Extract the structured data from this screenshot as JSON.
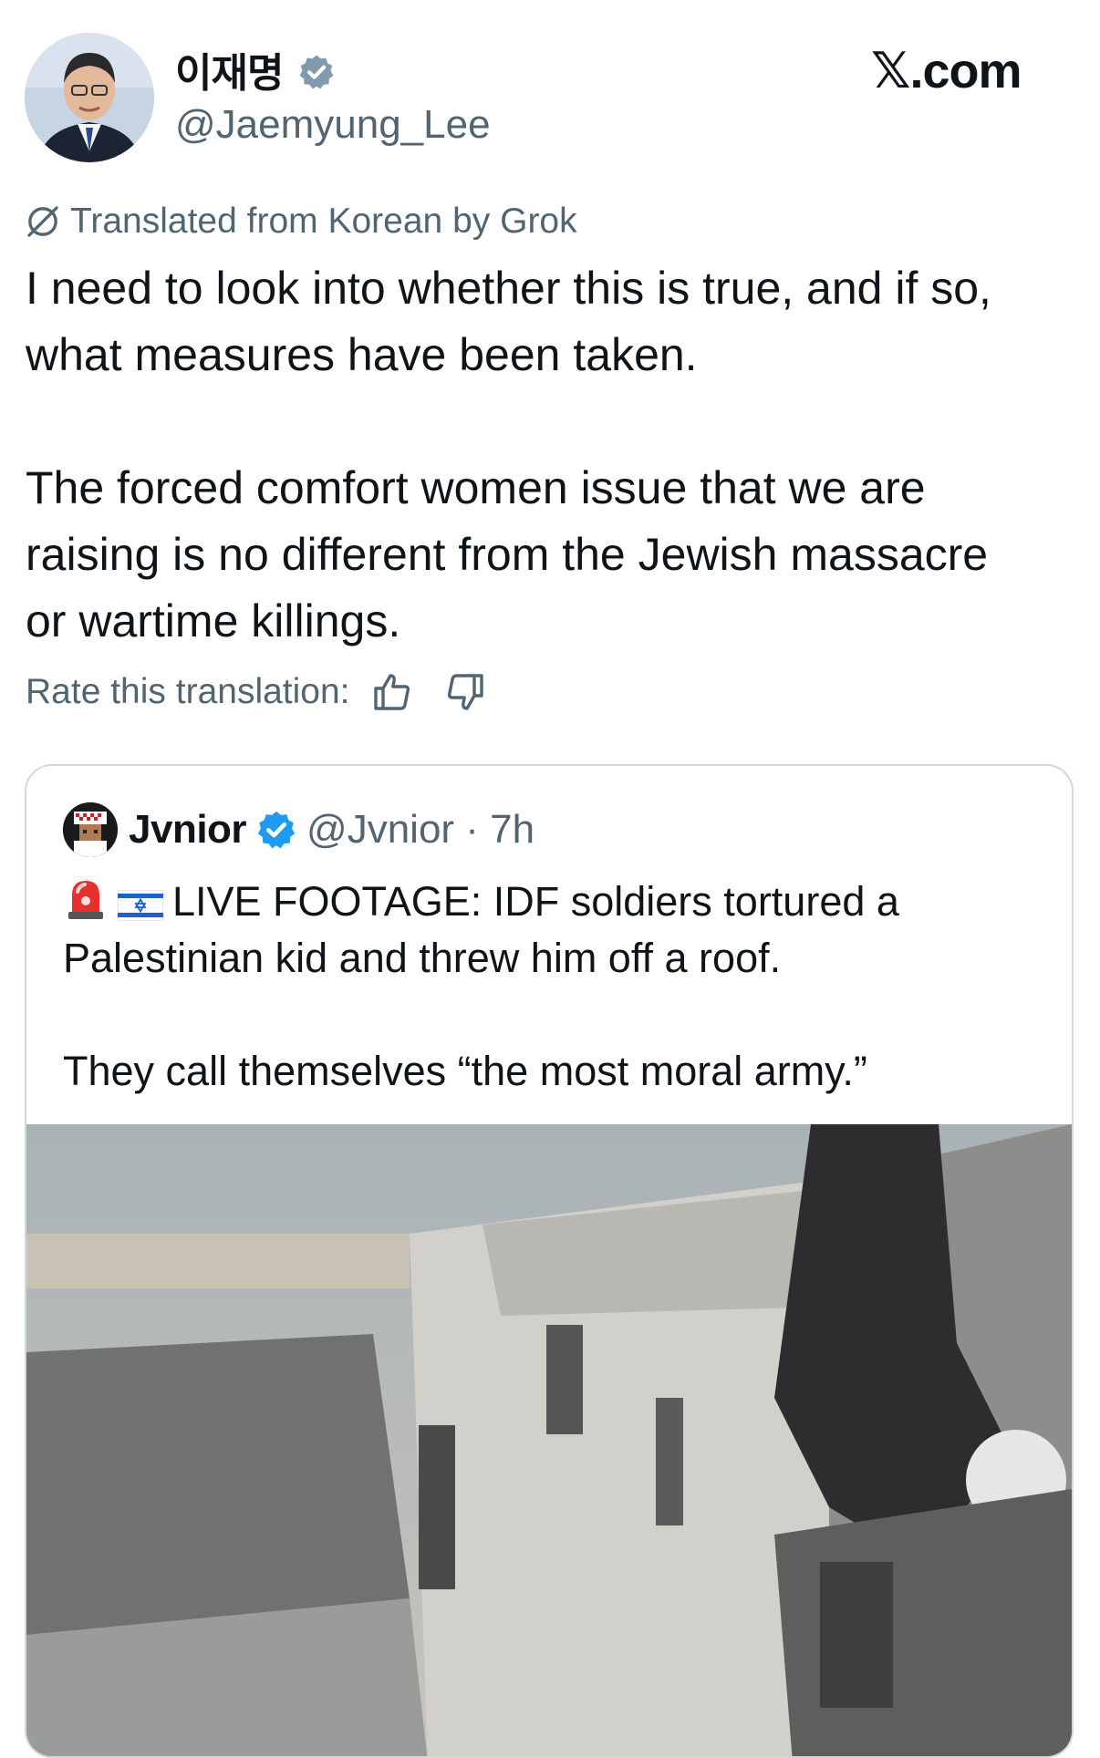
{
  "post": {
    "display_name": "이재명",
    "handle": "@Jaemyung_Lee",
    "brand": "𝕏.com",
    "translation_note": "Translated from Korean by Grok",
    "text": "I need to look into whether this is true, and if so,\nwhat measures have been taken.\n\nThe forced comfort women issue that we are\nraising is no different from the Jewish massacre\nor wartime killings.",
    "rate_label": "Rate this translation:"
  },
  "quote": {
    "display_name": "Jvnior",
    "handle_time": "@Jvnior · 7h",
    "text_line1": "LIVE FOOTAGE: IDF soldiers tortured a",
    "text_rest": "Palestinian kid and threw him off a roof.\n\nThey call themselves “the most moral army.”",
    "emoji": [
      "siren-emoji",
      "israel-flag-emoji"
    ]
  },
  "colors": {
    "text": "#0f1419",
    "secondary": "#536471",
    "verified_blue": "#1d9bf0",
    "verified_gray": "#829aab",
    "border": "#cfd9de"
  }
}
